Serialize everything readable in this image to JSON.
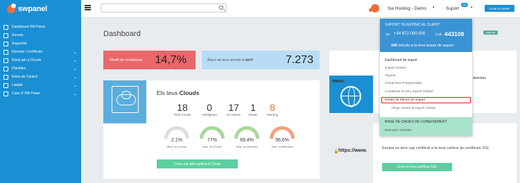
{
  "app": {
    "logo_text": "swpanel"
  },
  "sidebar": {
    "items": [
      {
        "label": "Dashboard SW Panel",
        "chev": ""
      },
      {
        "label": "Serveis",
        "chev": ""
      },
      {
        "label": "Seguretat",
        "chev": ""
      },
      {
        "label": "Dominis i Certificats",
        "chev": "⌄"
      },
      {
        "label": "Eines per a Clouds",
        "chev": "⌄"
      },
      {
        "label": "Plantilles",
        "chev": "⌄"
      },
      {
        "label": "Eines de Control",
        "chev": "⌄"
      },
      {
        "label": "Llistats",
        "chev": "⌄"
      },
      {
        "label": "Cues d' SW Panel",
        "chev": "⌄"
      }
    ]
  },
  "header": {
    "search_placeholder": "",
    "user_name": "Sw Hosting - Demo",
    "suport_label": "Suport",
    "suport_badge": "24h",
    "client_button": "Crear un servei"
  },
  "main": {
    "title": "Dashboard",
    "resiliencia": {
      "label": "Nivell de resiliència",
      "value": "14,7%"
    },
    "atacs": {
      "label_prefix": "Atacs als teus serveis el",
      "label_month": "abril",
      "value": "7.273"
    },
    "clouds": {
      "title_prefix": "Els teus",
      "title_bold": "Clouds",
      "stats": [
        {
          "n": "18",
          "l": "Total Clouds"
        },
        {
          "n": "0",
          "l": "Intelligents"
        },
        {
          "n": "17",
          "l": "En marxa"
        },
        {
          "n": "1",
          "l": "Parats"
        },
        {
          "n": "8",
          "l": "Warning"
        }
      ],
      "gauges": [
        {
          "v": "2,1%",
          "l": "Med. ús vCores"
        },
        {
          "v": "77%",
          "l": "Max. ús vCores"
        },
        {
          "v": "69,4%",
          "l": "Med. ús Memòria"
        },
        {
          "v": "96,6%",
          "l": "Max. ús Memòria"
        }
      ],
      "create_button": "Crea una altra aplicació Cloud"
    },
    "www": {
      "label": "www.",
      "dominis_text": "dominis"
    },
    "tag_grey": "2.500.000",
    "ssl": {
      "url": "https://www.",
      "text": "Encara no tens cap certificat a la teva cartera de certificats SSL",
      "button": "Crea un nou certificat SSL"
    }
  },
  "dropdown": {
    "title": "SUPORT TELEFÒNIC AL CLIENT",
    "tel_label": "Tel.",
    "tel_value": "+34 972 000 000",
    "codi_label": "Codi",
    "codi_value": "443108",
    "minutes_value": "240",
    "minutes_text": "minuts a la teva bossa de suport",
    "section_title": "Dashboard de suport",
    "items": [
      "Suport Gratuït",
      "Tiquets",
      "Actuacions Programades",
      "Actualitzar el meu Suport Global",
      "Gestió de Minuts de Suport"
    ],
    "sub_item": "Afegir minuts al Suport Global",
    "base_title": "BASE DE DADES DE CONEIXEMENT",
    "base_item": "Manuals i tutorials"
  }
}
